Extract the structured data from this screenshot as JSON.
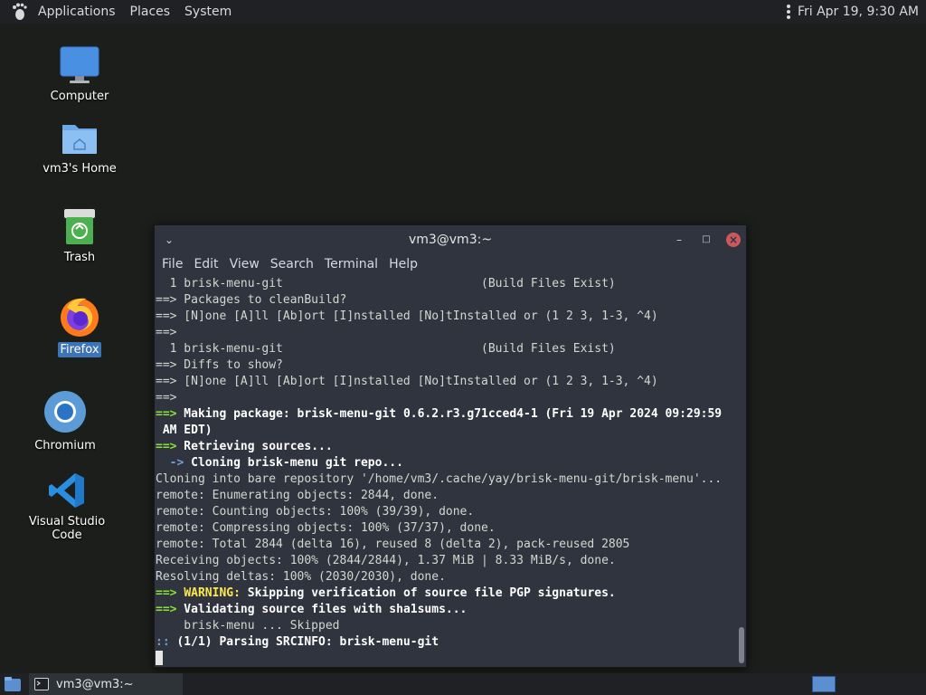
{
  "top_panel": {
    "menus": [
      "Applications",
      "Places",
      "System"
    ],
    "clock": "Fri Apr 19,  9:30 AM"
  },
  "desktop": {
    "icons": [
      {
        "label": "Computer"
      },
      {
        "label": "vm3's Home"
      },
      {
        "label": "Trash"
      },
      {
        "label": "Firefox"
      },
      {
        "label": "Chromium"
      },
      {
        "label": "Visual Studio Code"
      }
    ]
  },
  "terminal": {
    "title": "vm3@vm3:~",
    "menu": [
      "File",
      "Edit",
      "View",
      "Search",
      "Terminal",
      "Help"
    ],
    "lines": [
      "  1 brisk-menu-git                            (Build Files Exist)",
      "==> Packages to cleanBuild?",
      "==> [N]one [A]ll [Ab]ort [I]nstalled [No]tInstalled or (1 2 3, 1-3, ^4)",
      "==> ",
      "  1 brisk-menu-git                            (Build Files Exist)",
      "==> Diffs to show?",
      "==> [N]one [A]ll [Ab]ort [I]nstalled [No]tInstalled or (1 2 3, 1-3, ^4)",
      "==> ",
      "==> Making package: brisk-menu-git 0.6.2.r3.g71cced4-1 (Fri 19 Apr 2024 09:29:59",
      " AM EDT)",
      "==> Retrieving sources...",
      "  -> Cloning brisk-menu git repo...",
      "Cloning into bare repository '/home/vm3/.cache/yay/brisk-menu-git/brisk-menu'...",
      "remote: Enumerating objects: 2844, done.",
      "remote: Counting objects: 100% (39/39), done.",
      "remote: Compressing objects: 100% (37/37), done.",
      "remote: Total 2844 (delta 16), reused 8 (delta 2), pack-reused 2805",
      "Receiving objects: 100% (2844/2844), 1.37 MiB | 8.33 MiB/s, done.",
      "Resolving deltas: 100% (2030/2030), done.",
      "==> WARNING: Skipping verification of source file PGP signatures.",
      "==> Validating source files with sha1sums...",
      "    brisk-menu ... Skipped",
      ":: (1/1) Parsing SRCINFO: brisk-menu-git"
    ]
  },
  "bottom_panel": {
    "task_label": "vm3@vm3:~"
  },
  "colors": {
    "accent": "#3d74b6",
    "prompt_green": "#8ae234",
    "warning_yellow": "#fce94f",
    "close_red": "#cc575d"
  }
}
